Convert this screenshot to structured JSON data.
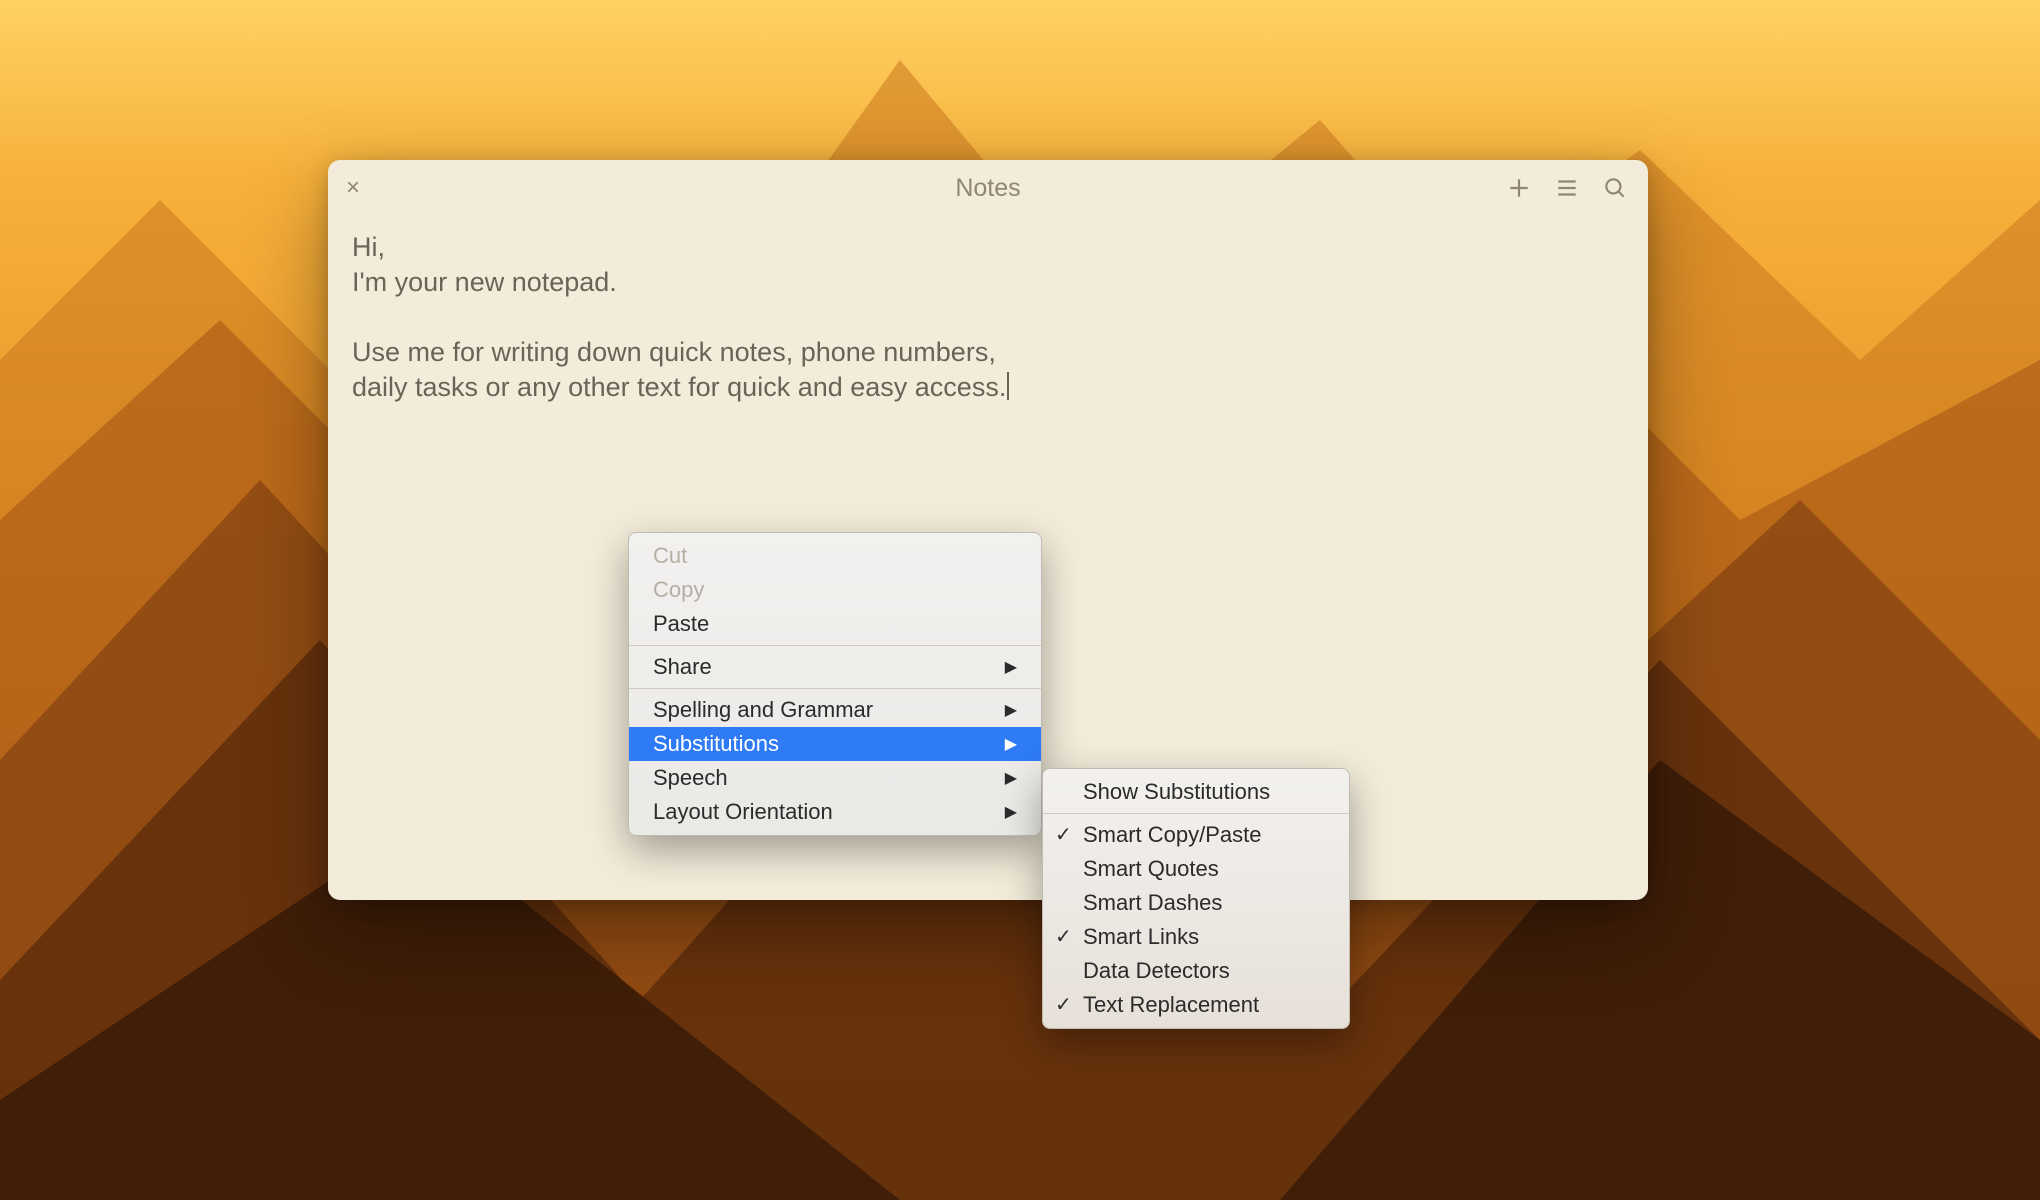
{
  "window": {
    "title": "Notes"
  },
  "note": {
    "line1": "Hi,",
    "line2": "I'm your new notepad.",
    "line3": "Use me for writing down quick notes, phone numbers,",
    "line4": "daily tasks or any other text for quick and easy access."
  },
  "context_menu": {
    "cut": "Cut",
    "copy": "Copy",
    "paste": "Paste",
    "share": "Share",
    "spelling": "Spelling and Grammar",
    "substitutions": "Substitutions",
    "speech": "Speech",
    "layout": "Layout Orientation"
  },
  "submenu": {
    "show": "Show Substitutions",
    "smart_copy": "Smart Copy/Paste",
    "smart_quotes": "Smart Quotes",
    "smart_dashes": "Smart Dashes",
    "smart_links": "Smart Links",
    "data_detectors": "Data Detectors",
    "text_replacement": "Text Replacement"
  }
}
